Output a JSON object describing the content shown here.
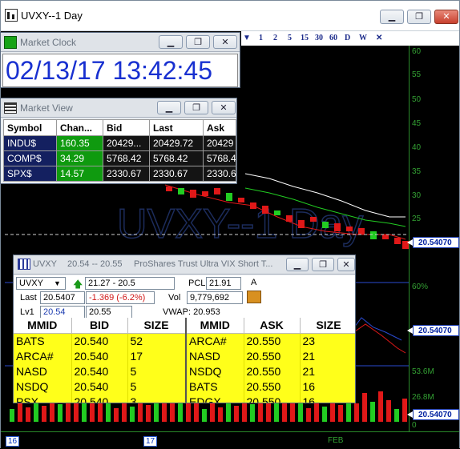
{
  "chart_window": {
    "title": "UVXY--1 Day",
    "watermark": "UVXY--1 Day",
    "toolbar": [
      "1",
      "2",
      "5",
      "15",
      "30",
      "60",
      "D",
      "W"
    ],
    "y_ticks_price": [
      "60",
      "55",
      "50",
      "45",
      "40",
      "35",
      "30",
      "25",
      "20"
    ],
    "y_ticks_indicator": [
      "60%",
      "20%"
    ],
    "y_ticks_volume": [
      "53.6M",
      "26.8M",
      "0"
    ],
    "price_tag": "20.54070",
    "x_labels": [
      "16",
      "17",
      "FEB"
    ],
    "colors": {
      "background": "#000000",
      "up": "#22cc22",
      "down": "#e01818",
      "axis": "#33a033"
    }
  },
  "market_clock": {
    "title": "Market Clock",
    "time": "02/13/17 13:42:45"
  },
  "market_view": {
    "title": "Market View",
    "headers": [
      "Symbol",
      "Chan...",
      "Bid",
      "Last",
      "Ask"
    ],
    "rows": [
      [
        "INDU$",
        "160.35",
        "20429...",
        "20429.72",
        "20429"
      ],
      [
        "COMP$",
        "34.29",
        "5768.42",
        "5768.42",
        "5768.4"
      ],
      [
        "SPX$",
        "14.57",
        "2330.67",
        "2330.67",
        "2330.6"
      ]
    ]
  },
  "level2": {
    "symbol": "UVXY",
    "title_range": "20.54 -- 20.55",
    "title_desc": "ProShares Trust Ultra VIX Short T...",
    "range": "21.27 - 20.5",
    "pcl_label": "PCL",
    "pcl": "21.91",
    "a_label": "A",
    "last_label": "Last",
    "last": "20.5407",
    "change": "-1.369  (-6.2%)",
    "vol_label": "Vol",
    "vol": "9,779,692",
    "lv1_label": "Lv1",
    "lv1_bid": "20.54",
    "lv1_ask": "20.55",
    "vwap": "VWAP: 20.953",
    "bid_headers": [
      "MMID",
      "BID",
      "SIZE"
    ],
    "ask_headers": [
      "MMID",
      "ASK",
      "SIZE"
    ],
    "bids": [
      [
        "BATS",
        "20.540",
        "52"
      ],
      [
        "ARCA#",
        "20.540",
        "17"
      ],
      [
        "NASD",
        "20.540",
        "5"
      ],
      [
        "NSDQ",
        "20.540",
        "5"
      ],
      [
        "PSX",
        "20.540",
        "3"
      ]
    ],
    "asks": [
      [
        "ARCA#",
        "20.550",
        "23"
      ],
      [
        "NASD",
        "20.550",
        "21"
      ],
      [
        "NSDQ",
        "20.550",
        "21"
      ],
      [
        "BATS",
        "20.550",
        "16"
      ],
      [
        "EDGX",
        "20.550",
        "16"
      ]
    ]
  }
}
